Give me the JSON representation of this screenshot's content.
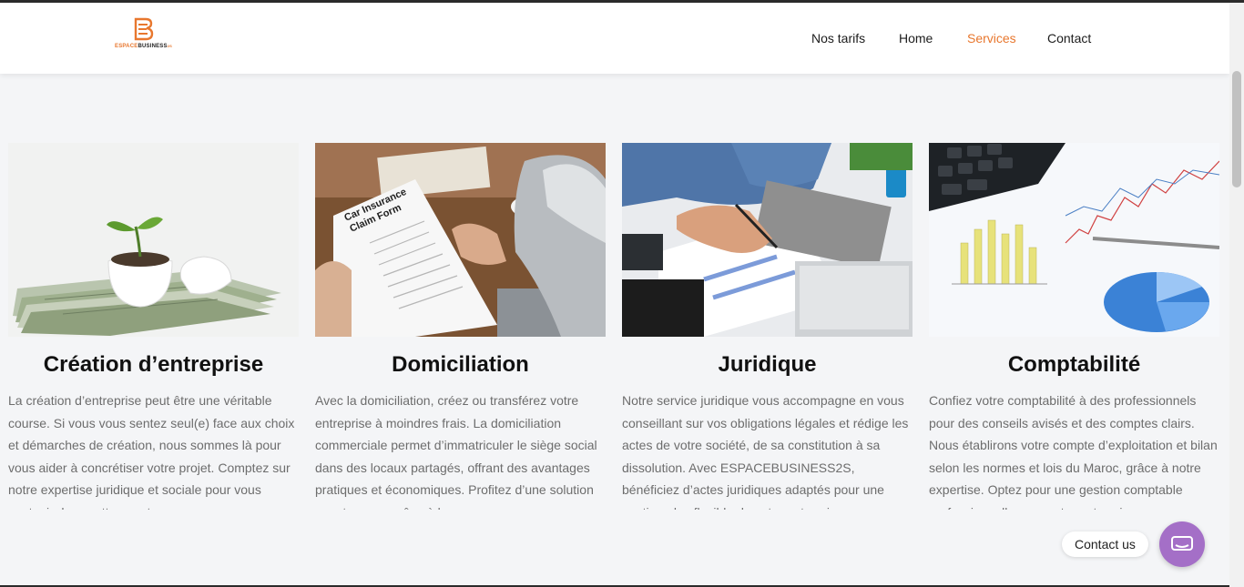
{
  "brand": {
    "part1": "ESPACE",
    "part2": "BUSINESS",
    "part3": "2S",
    "colors": {
      "accent": "#e8772e",
      "dark": "#222222"
    }
  },
  "nav": {
    "items": [
      {
        "label": "Nos tarifs",
        "active": false
      },
      {
        "label": "Home",
        "active": false
      },
      {
        "label": "Services",
        "active": true
      },
      {
        "label": "Contact",
        "active": false
      }
    ]
  },
  "cards": [
    {
      "title": "Création d’entreprise",
      "text": "La création d’entreprise peut être une véritable course. Si vous vous sentez seul(e) face aux choix et démarches de création, nous sommes là pour vous aider à concrétiser votre projet. Comptez sur notre expertise juridique et sociale pour vous soutenir dans cette aventure"
    },
    {
      "title": "Domiciliation",
      "text": "Avec la domiciliation, créez ou transférez votre entreprise à moindres frais. La domiciliation commerciale permet d’immatriculer le siège social dans des locaux partagés, offrant des avantages pratiques et économiques. Profitez d’une solution avantageuse grâce à la",
      "image_text": {
        "form_title_1": "Car Insurance",
        "form_title_2": "Claim Form"
      }
    },
    {
      "title": "Juridique",
      "text": "Notre service juridique vous accompagne en vous conseillant sur vos obligations légales et rédige les actes de votre société, de sa constitution à sa dissolution. Avec ESPACEBUSINESS2S, bénéficiez d’actes juridiques adaptés pour une gestion plus flexible de votre entreprise."
    },
    {
      "title": "Comptabilité",
      "text": "Confiez votre comptabilité à des professionnels pour des conseils avisés et des comptes clairs. Nous établirons votre compte d’exploitation et bilan selon les normes et lois du Maroc, grâce à notre expertise. Optez pour une gestion comptable professionnelle pour votre entreprise."
    }
  ],
  "contact_widget": {
    "label": "Contact us",
    "color": "#a46fc7"
  }
}
